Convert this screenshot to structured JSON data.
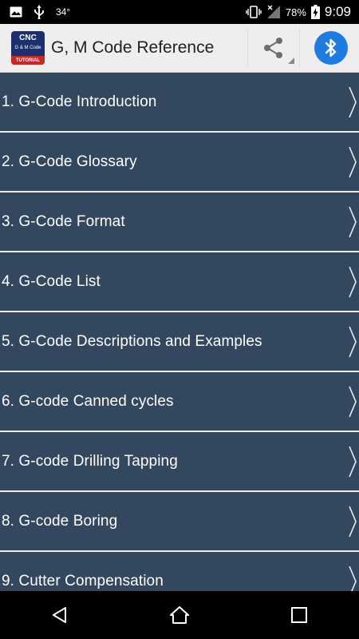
{
  "statusbar": {
    "temperature": "34°",
    "battery_percent": "78%",
    "time": "9:09",
    "icons": [
      "image-icon",
      "usb-icon",
      "vibrate-icon",
      "no-signal-icon",
      "battery-charging-icon"
    ]
  },
  "appbar": {
    "title": "G, M Code Reference",
    "logo": {
      "line1": "CNC",
      "line2": "G & M Code",
      "line3": "TUTORIAL"
    },
    "share_icon": "share-icon",
    "bluetooth_icon": "bluetooth-icon",
    "accent_color": "#1e7ce0"
  },
  "list": {
    "background_color": "#33475e",
    "items": [
      {
        "label": "1. G-Code Introduction"
      },
      {
        "label": "2. G-Code Glossary"
      },
      {
        "label": "3. G-Code Format"
      },
      {
        "label": "4. G-Code List"
      },
      {
        "label": "5. G-Code Descriptions and Examples"
      },
      {
        "label": "6. G-code Canned cycles"
      },
      {
        "label": "7. G-code Drilling Tapping"
      },
      {
        "label": "8. G-code Boring"
      },
      {
        "label": "9. Cutter Compensation"
      }
    ]
  },
  "navbar": {
    "buttons": [
      "back-icon",
      "home-icon",
      "recents-icon"
    ]
  }
}
